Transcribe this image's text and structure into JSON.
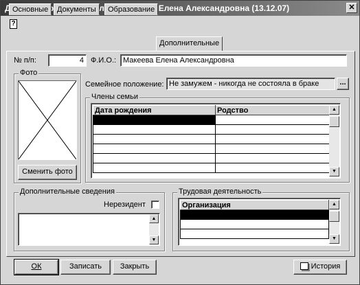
{
  "window": {
    "title": "Данные о физическом лице:Макеева Елена Александровна (13.12.07)",
    "close_glyph": "✕",
    "help_glyph": "?"
  },
  "tabs": [
    {
      "label": "Основные",
      "active": false
    },
    {
      "label": "Документы",
      "active": false
    },
    {
      "label": "Образование",
      "active": false
    },
    {
      "label": "Дополнительные",
      "active": true
    }
  ],
  "form": {
    "number_label": "№ п/п:",
    "number_value": "4",
    "fio_label": "Ф.И.О.:",
    "fio_value": "Макеева Елена Александровна",
    "photo_group_title": "Фото",
    "change_photo_button": "Сменить фото",
    "marital_label": "Семейное положение:",
    "marital_value": "Не замужем - никогда не состояла в браке",
    "marital_select_glyph": "...",
    "family_group_title": "Члены семьи",
    "family_columns": [
      "Дата рождения",
      "Родство"
    ],
    "additional_group_title": "Дополнительные сведения",
    "nonresident_label": "Нерезидент",
    "nonresident_checked": false,
    "work_group_title": "Трудовая деятельность",
    "work_columns": [
      "Организация"
    ]
  },
  "buttons": {
    "ok": "ОК",
    "save": "Записать",
    "close": "Закрыть",
    "history": "История"
  }
}
